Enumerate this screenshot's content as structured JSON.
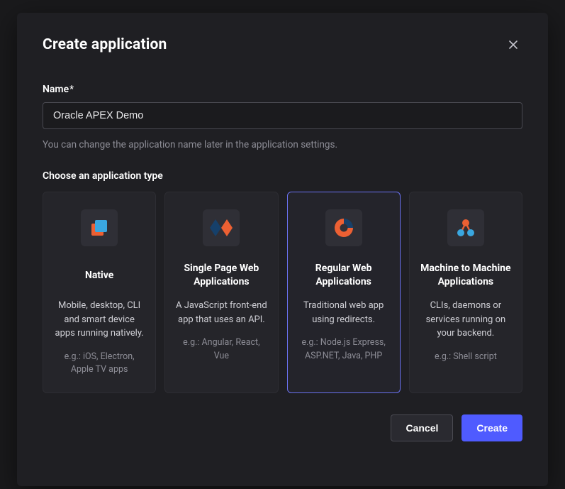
{
  "modal": {
    "title": "Create application",
    "close_aria": "Close"
  },
  "name_field": {
    "label": "Name",
    "required_marker": "*",
    "value": "Oracle APEX Demo",
    "helper": "You can change the application name later in the application settings."
  },
  "type_section": {
    "label": "Choose an application type",
    "selected_index": 2,
    "cards": [
      {
        "icon": "native-icon",
        "title": "Native",
        "desc": "Mobile, desktop, CLI and smart device apps running natively.",
        "eg": "e.g.: iOS, Electron, Apple TV apps"
      },
      {
        "icon": "spa-icon",
        "title": "Single Page Web Applications",
        "desc": "A JavaScript front-end app that uses an API.",
        "eg": "e.g.: Angular, React, Vue"
      },
      {
        "icon": "regular-web-icon",
        "title": "Regular Web Applications",
        "desc": "Traditional web app using redirects.",
        "eg": "e.g.: Node.js Express, ASP.NET, Java, PHP"
      },
      {
        "icon": "m2m-icon",
        "title": "Machine to Machine Applications",
        "desc": "CLIs, daemons or services running on your backend.",
        "eg": "e.g.: Shell script"
      }
    ]
  },
  "footer": {
    "cancel": "Cancel",
    "create": "Create"
  },
  "colors": {
    "accent": "#4f5bff",
    "selected_border": "#6a71f1",
    "orange": "#ec6033",
    "blue": "#3aa7e0",
    "darkblue": "#16406a"
  }
}
